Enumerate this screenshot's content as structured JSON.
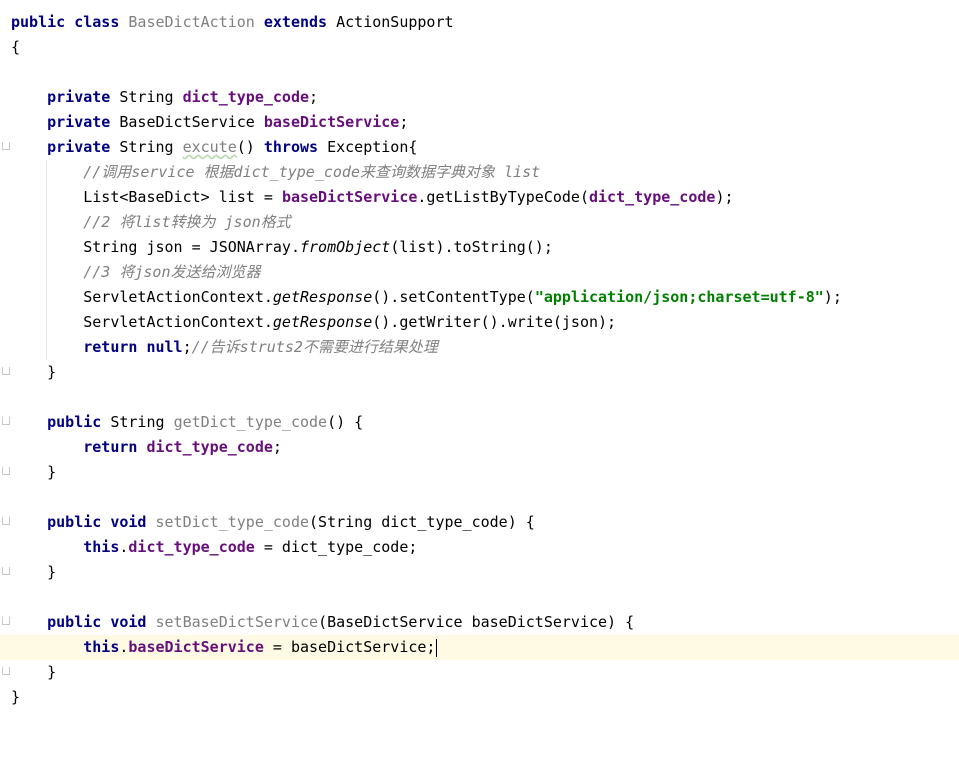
{
  "code": {
    "kw_public": "public",
    "kw_class": "class",
    "kw_extends": "extends",
    "kw_private": "private",
    "kw_throws": "throws",
    "kw_return": "return",
    "kw_null": "null",
    "kw_this": "this",
    "kw_void": "void",
    "class_name": "BaseDictAction",
    "super_class": "ActionSupport",
    "type_string": "String",
    "type_service": "BaseDictService",
    "field_type_code": "dict_type_code",
    "field_service": "baseDictService",
    "method_excute": "excute",
    "exception": "Exception",
    "comment1": "//调用service 根据dict_type_code来查询数据字典对象 list",
    "list_decl": "List<BaseDict> list = ",
    "get_list_call": ".getListByTypeCode(",
    "comment2": "//2 将list转换为 json格式",
    "json_decl": "String json = JSONArray.",
    "from_object": "fromObject",
    "to_string_tail": "(list).toString();",
    "comment3": "//3 将json发送给浏览器",
    "servlet_ctx": "ServletActionContext.",
    "get_response": "getResponse",
    "set_content_type": "().setContentType(",
    "content_type_str": "\"application/json;charset=utf-8\"",
    "get_writer": "().getWriter().write(json);",
    "comment4": "//告诉struts2不需要进行结果处理",
    "getter_name": "getDict_type_code",
    "setter_type_code": "setDict_type_code",
    "setter_service": "setBaseDictService",
    "param_type_code": "(String dict_type_code) {",
    "param_service": "(BaseDictService baseDictService) {",
    "assign_type_code": " = dict_type_code;",
    "assign_service": " = baseDictService;"
  }
}
